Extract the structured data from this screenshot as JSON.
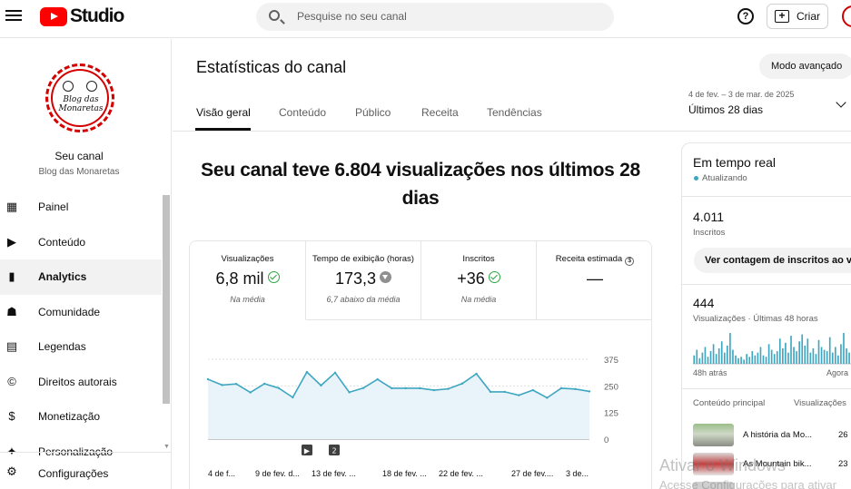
{
  "topbar": {
    "brand": "Studio",
    "search_placeholder": "Pesquise no seu canal",
    "create_label": "Criar"
  },
  "sidebar": {
    "logo_text": "Blog das Monaretas",
    "channel_name": "Seu canal",
    "channel_handle": "Blog das Monaretas",
    "items": [
      {
        "label": "Painel",
        "icon": "dashboard-icon",
        "active": false
      },
      {
        "label": "Conteúdo",
        "icon": "content-icon",
        "active": false
      },
      {
        "label": "Analytics",
        "icon": "analytics-icon",
        "active": true
      },
      {
        "label": "Comunidade",
        "icon": "community-icon",
        "active": false
      },
      {
        "label": "Legendas",
        "icon": "subtitles-icon",
        "active": false
      },
      {
        "label": "Direitos autorais",
        "icon": "copyright-icon",
        "active": false
      },
      {
        "label": "Monetização",
        "icon": "monetization-icon",
        "active": false
      },
      {
        "label": "Personalização",
        "icon": "customization-icon",
        "active": false
      }
    ],
    "settings_label": "Configurações"
  },
  "header": {
    "title": "Estatísticas do canal",
    "advanced_mode": "Modo avançado",
    "tabs": [
      "Visão geral",
      "Conteúdo",
      "Público",
      "Receita",
      "Tendências"
    ],
    "active_tab": "Visão geral",
    "date_range": "4 de fev. – 3 de mar. de 2025",
    "period": "Últimos 28 dias"
  },
  "overview": {
    "headline": "Seu canal teve 6.804 visualizações nos últimos 28 dias",
    "metrics": [
      {
        "label": "Visualizações",
        "value": "6,8 mil",
        "status": "ok",
        "note": "Na média"
      },
      {
        "label": "Tempo de exibição (horas)",
        "value": "173,3",
        "status": "down",
        "note": "6,7 abaixo da média"
      },
      {
        "label": "Inscritos",
        "value": "+36",
        "status": "ok",
        "note": "Na média"
      },
      {
        "label": "Receita estimada",
        "value": "—",
        "status": "info",
        "note": ""
      }
    ]
  },
  "chart_data": {
    "type": "area",
    "title": "",
    "xlabel": "",
    "ylabel": "",
    "ylim": [
      0,
      375
    ],
    "yticks": [
      0,
      125,
      250,
      375
    ],
    "xtick_labels": [
      "4 de f...",
      "9 de fev. d...",
      "13 de fev. ...",
      "18 de fev. ...",
      "22 de fev. ...",
      "27 de fev....",
      "3 de..."
    ],
    "markers": [
      "▶",
      "2"
    ],
    "series": [
      {
        "values": [
          281,
          254,
          259,
          219,
          260,
          240,
          196,
          315,
          252,
          312,
          220,
          240,
          281,
          239,
          239,
          239,
          230,
          236,
          261,
          307,
          222,
          222,
          206,
          230,
          194,
          239,
          235,
          224
        ]
      }
    ],
    "color": "#3ea6c1"
  },
  "realtime": {
    "title": "Em tempo real",
    "status": "Atualizando",
    "subscribers_value": "4.011",
    "subscribers_label": "Inscritos",
    "subscribers_button": "Ver contagem de inscritos ao vivo",
    "views_value": "444",
    "views_label": "Visualizações · Últimas 48 horas",
    "axis_left": "48h atrás",
    "axis_right": "Agora",
    "top_content_label": "Conteúdo principal",
    "top_content_col": "Visualizações",
    "bars": [
      6,
      10,
      4,
      8,
      12,
      5,
      9,
      14,
      7,
      11,
      16,
      8,
      13,
      22,
      10,
      6,
      4,
      5,
      3,
      7,
      5,
      9,
      6,
      8,
      12,
      6,
      5,
      14,
      10,
      7,
      9,
      18,
      11,
      15,
      8,
      20,
      12,
      9,
      16,
      21,
      13,
      18,
      8,
      11,
      7,
      17,
      12,
      10,
      9,
      19,
      8,
      12,
      6,
      14,
      22,
      11,
      8,
      10,
      16
    ],
    "videos": [
      {
        "title": "A história da Mo...",
        "views": "26"
      },
      {
        "title": "As Mountain bik...",
        "views": "23"
      }
    ]
  },
  "watermark": {
    "line1": "Ativar o Windows",
    "line2": "Acesse Configurações para ativar"
  }
}
